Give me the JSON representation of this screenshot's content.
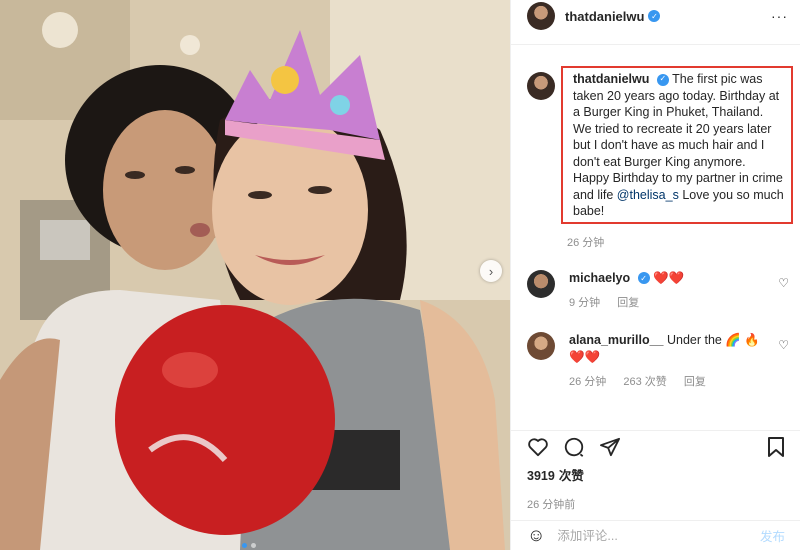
{
  "post": {
    "username": "thatdanielwu",
    "more_icon": "···"
  },
  "caption": {
    "username": "thatdanielwu",
    "text": "The first pic was taken 20 years ago today. Birthday at a Burger King in Phuket, Thailand. We tried to recreate it 20 years later but I don't have as much hair and I don't eat Burger King anymore. Happy Birthday to my partner in crime and life",
    "mention": "@thelisa_s",
    "text_after": "Love you so much babe!",
    "time": "26 分钟"
  },
  "comments": [
    {
      "username": "michaelyo",
      "text": "❤️❤️",
      "time": "9 分钟",
      "reply": "回复"
    },
    {
      "username": "alana_murillo__",
      "text": "Under the 🌈 🔥 ❤️❤️",
      "time": "26 分钟",
      "likes": "263 次赞",
      "reply": "回复"
    }
  ],
  "likes": {
    "count": "3919",
    "suffix": "次赞"
  },
  "timestamp": "26 分钟前",
  "input": {
    "placeholder": "添加评论...",
    "post_label": "发布"
  },
  "colors": {
    "accent": "#3897f0",
    "highlight_border": "#e23a2f",
    "heart": "#e0282e"
  }
}
